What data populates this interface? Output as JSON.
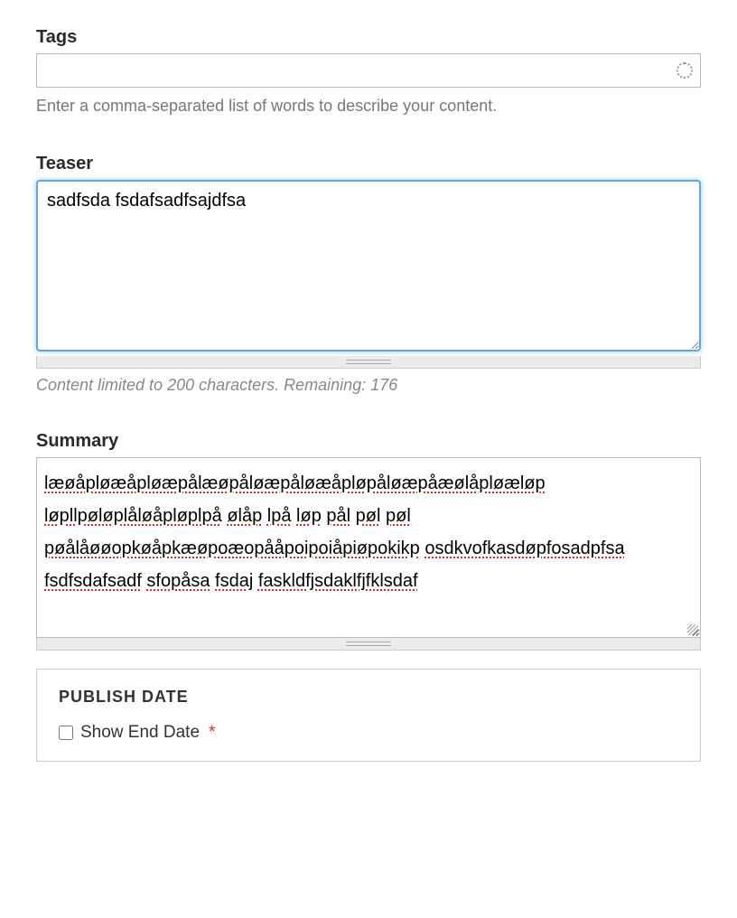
{
  "tags": {
    "label": "Tags",
    "value": "",
    "help": "Enter a comma-separated list of words to describe your content."
  },
  "teaser": {
    "label": "Teaser",
    "value": "sadfsda fsdafsadfsajdfsa",
    "limit_prefix": "Content limited to ",
    "limit_chars": "200",
    "limit_mid": " characters. Remaining: ",
    "remaining": "176"
  },
  "summary": {
    "label": "Summary",
    "value": "læøåpløæåpløæpålæøpåløæpåløæåpløpåløæpåæølåpløæløp løpllpøløplåløåpløplpå ølåp lpå løp pål pøl pøl pøålåøøopkøåpkæøpoæopååpoipoiåpiøpokikp osdkvofkasdøpfosadpfsa fsdfsdafsadf sfopåsa fsdaj faskldfjsdaklfjfklsdaf"
  },
  "publish_date": {
    "legend": "PUBLISH DATE",
    "show_end_date_label": "Show End Date"
  }
}
